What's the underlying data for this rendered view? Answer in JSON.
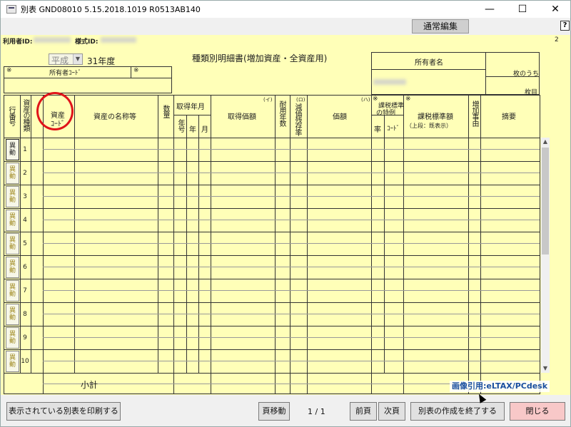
{
  "window": {
    "title": "別表 GND08010  5.15.2018.1019  R0513AB140",
    "minimize": "—",
    "maximize": "☐",
    "close": "✕"
  },
  "mode_button": "通常編集",
  "help": "?",
  "header": {
    "user_id_label": "利用者ID:",
    "form_id_label": "様式ID:",
    "page_num": "2",
    "era_value": "平成",
    "year_label": "31年度",
    "form_title": "種類別明細書(増加資産・全資産用)",
    "owner_name_label": "所有者名",
    "owner_code_label": "所有者ｺｰﾄﾞ",
    "mark": "※",
    "sheets_of_label": "枚のうち",
    "sheet_label": "枚目"
  },
  "columns": {
    "row_no": "行番号",
    "asset_type": "資産の種類",
    "asset_code_1": "資産",
    "asset_code_2": "ｺｰﾄﾞ",
    "asset_name": "資産の名称等",
    "quantity": "数量",
    "acq_date": "取得年月",
    "era": "年号",
    "year": "年",
    "month": "月",
    "acq_cost": "取得価額",
    "acq_cost_mark": "(イ)",
    "useful_life": "耐用年数",
    "residual_rate": "減価残存率",
    "residual_mark": "(ロ)",
    "value": "価額",
    "value_mark": "(ハ)",
    "special_1": "課税標準",
    "special_2": "の特例",
    "special_rate": "率",
    "special_code": "ｺｰﾄﾞ",
    "tax_base": "課税標準額",
    "tax_base_note": "（上段：既表示）",
    "increase_reason": "増加事由",
    "remarks": "摘要"
  },
  "rows": [
    {
      "button": "異動",
      "no": "1"
    },
    {
      "button": "異動",
      "no": "2"
    },
    {
      "button": "異動",
      "no": "3"
    },
    {
      "button": "異動",
      "no": "4"
    },
    {
      "button": "異動",
      "no": "5"
    },
    {
      "button": "異動",
      "no": "6"
    },
    {
      "button": "異動",
      "no": "7"
    },
    {
      "button": "異動",
      "no": "8"
    },
    {
      "button": "異動",
      "no": "9"
    },
    {
      "button": "異動",
      "no": "10"
    }
  ],
  "subtotal_label": "小計",
  "credit": "画像引用:eLTAX/PCdesk",
  "footer": {
    "print_button": "表示されている別表を印刷する",
    "page_jump_button": "頁移動",
    "page_indicator": "1  /  1",
    "prev_button": "前頁",
    "next_button": "次頁",
    "finish_button": "別表の作成を終了する",
    "close_button": "閉じる"
  }
}
